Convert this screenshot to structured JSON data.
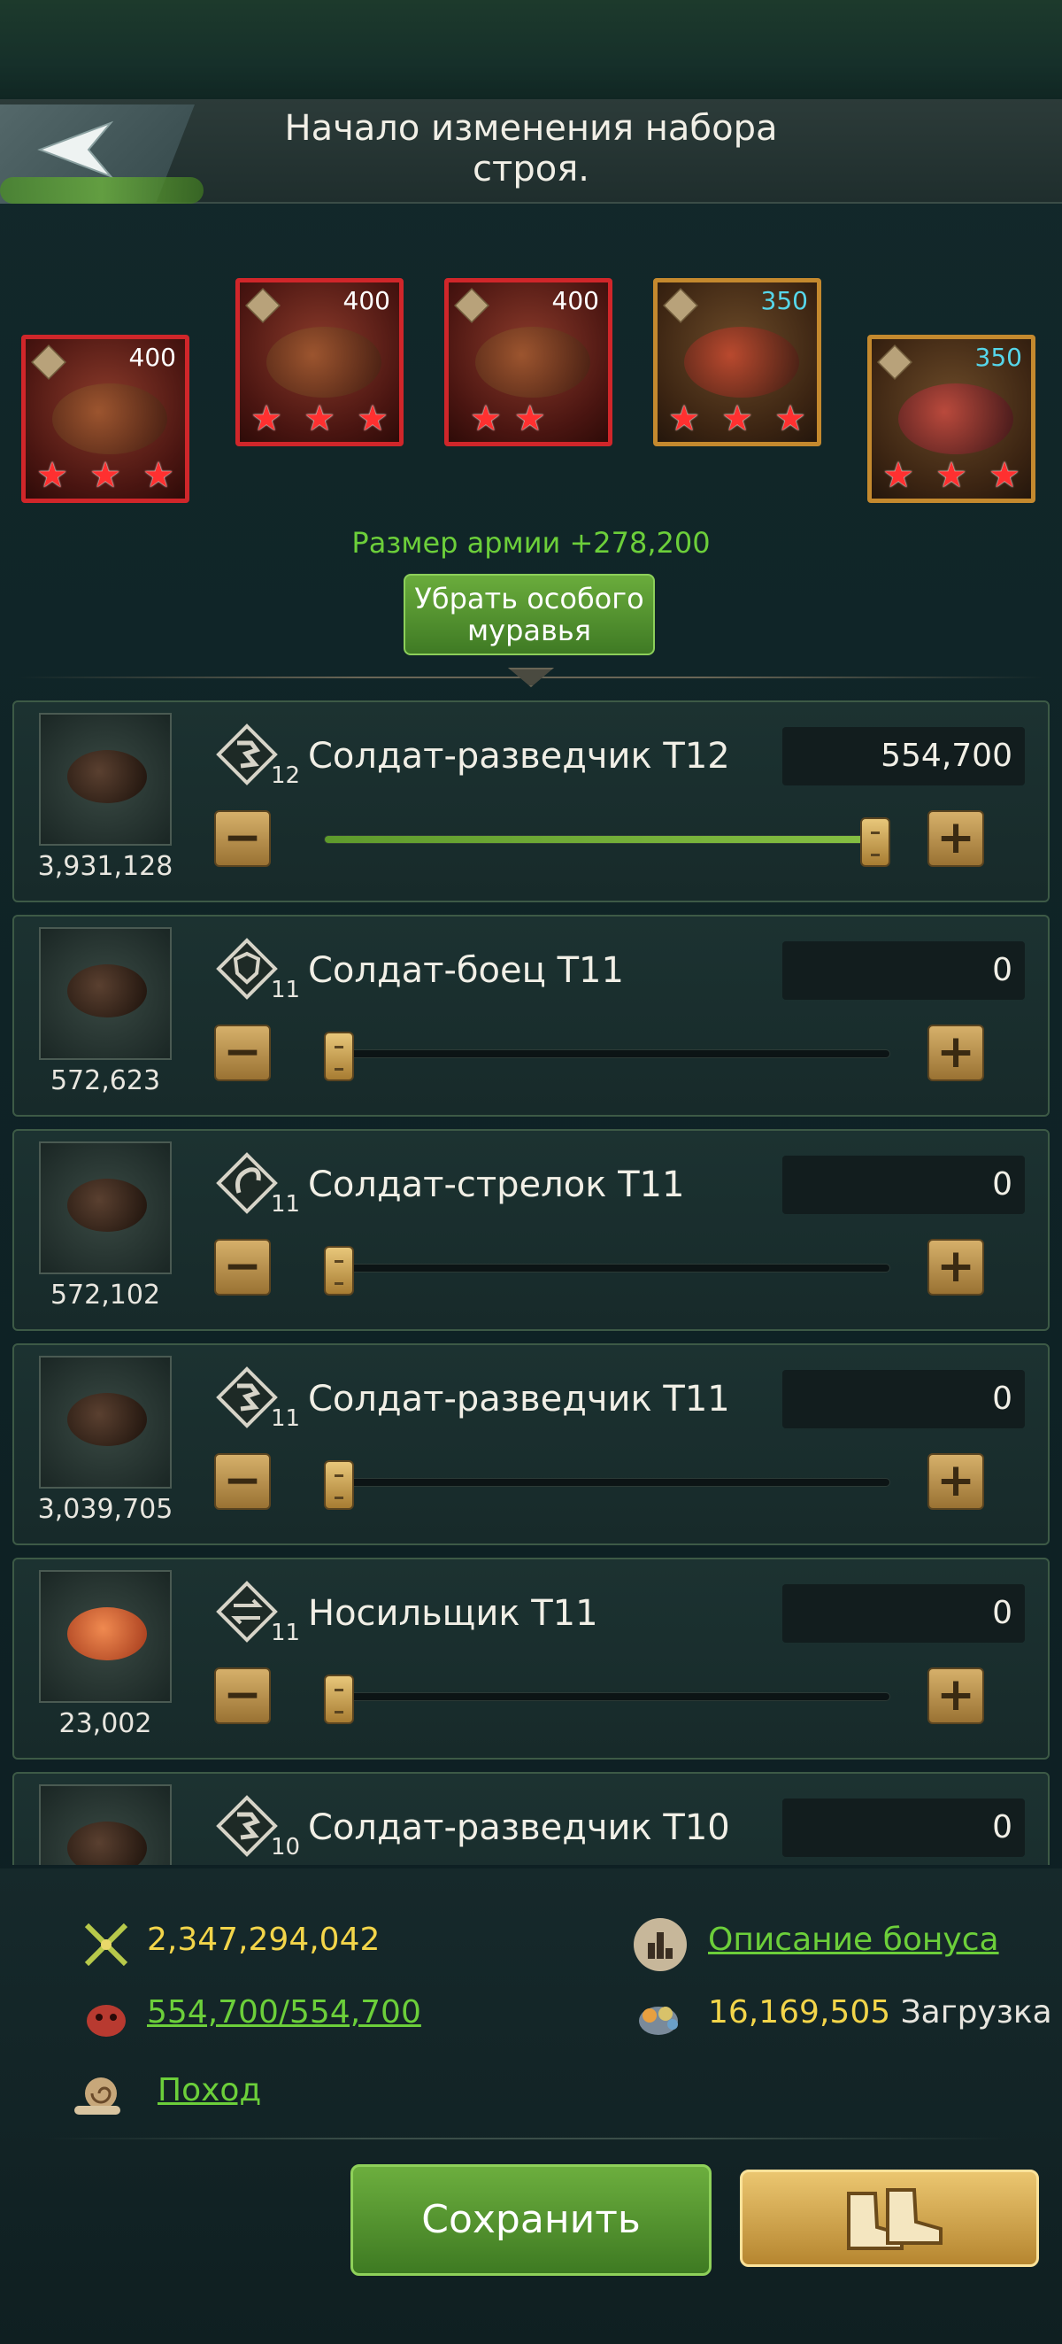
{
  "header": {
    "title": "Начало изменения набора строя."
  },
  "army_cards": [
    {
      "count": "400",
      "stars": 3,
      "frame": "red"
    },
    {
      "count": "400",
      "stars": 3,
      "frame": "red"
    },
    {
      "count": "400",
      "stars": 2,
      "frame": "red"
    },
    {
      "count": "350",
      "stars": 3,
      "frame": "gold"
    },
    {
      "count": "350",
      "stars": 3,
      "frame": "gold"
    }
  ],
  "army_size_label": "Размер армии +278,200",
  "remove_special_label": "Убрать особого муравья",
  "troops": [
    {
      "name": "Солдат-разведчик T12",
      "tier": "12",
      "power": "3,931,128",
      "quantity": "554,700",
      "fill": 1.0
    },
    {
      "name": "Солдат-боец T11",
      "tier": "11",
      "power": "572,623",
      "quantity": "0",
      "fill": 0
    },
    {
      "name": "Солдат-стрелок T11",
      "tier": "11",
      "power": "572,102",
      "quantity": "0",
      "fill": 0
    },
    {
      "name": "Солдат-разведчик T11",
      "tier": "11",
      "power": "3,039,705",
      "quantity": "0",
      "fill": 0
    },
    {
      "name": "Носильщик T11",
      "tier": "11",
      "power": "23,002",
      "quantity": "0",
      "fill": 0
    },
    {
      "name": "Солдат-разведчик T10",
      "tier": "10",
      "power": "",
      "quantity": "0",
      "fill": 0
    }
  ],
  "footer": {
    "total_power": "2,347,294,042",
    "troop_count": "554,700/554,700",
    "bonus_link": "Описание бонуса",
    "load_value": "16,169,505",
    "load_label": "Загрузка",
    "march_link": "Поход",
    "save_label": "Сохранить"
  },
  "colors": {
    "accent_green": "#6ccf3a",
    "accent_yellow": "#f3d54a",
    "frame_red": "#d0262a",
    "frame_gold": "#c4892e"
  }
}
